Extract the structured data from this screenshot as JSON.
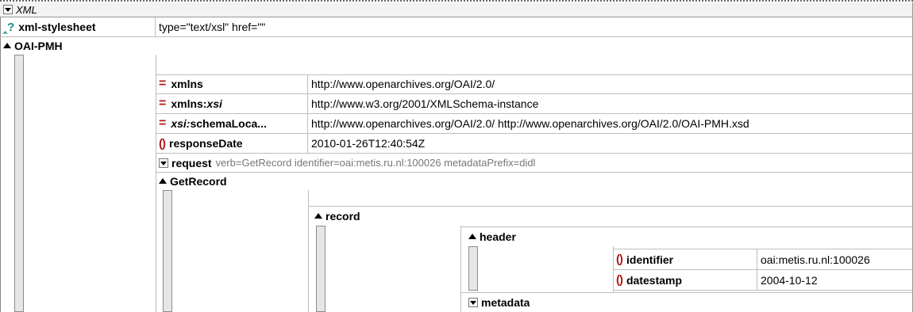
{
  "root": {
    "label": "XML"
  },
  "pi": {
    "name": "xml-stylesheet",
    "value": "type=\"text/xsl\" href=\"\""
  },
  "oai": {
    "name": "OAI-PMH",
    "attrs": [
      {
        "prefix": "",
        "name": "xmlns",
        "value": "http://www.openarchives.org/OAI/2.0/"
      },
      {
        "prefix": "xmlns:",
        "name": "xsi",
        "value": "http://www.w3.org/2001/XMLSchema-instance"
      },
      {
        "prefix": "xsi:",
        "name": "schemaLoca...",
        "value": "http://www.openarchives.org/OAI/2.0/ http://www.openarchives.org/OAI/2.0/OAI-PMH.xsd"
      }
    ],
    "responseDate": {
      "name": "responseDate",
      "value": "2010-01-26T12:40:54Z"
    },
    "request": {
      "name": "request",
      "attrs": "verb=GetRecord identifier=oai:metis.ru.nl:100026 metadataPrefix=didl"
    },
    "getRecord": {
      "name": "GetRecord",
      "record": {
        "name": "record",
        "header": {
          "name": "header",
          "identifier": {
            "name": "identifier",
            "value": "oai:metis.ru.nl:100026"
          },
          "datestamp": {
            "name": "datestamp",
            "value": "2004-10-12"
          }
        },
        "metadata": {
          "name": "metadata"
        }
      }
    }
  }
}
